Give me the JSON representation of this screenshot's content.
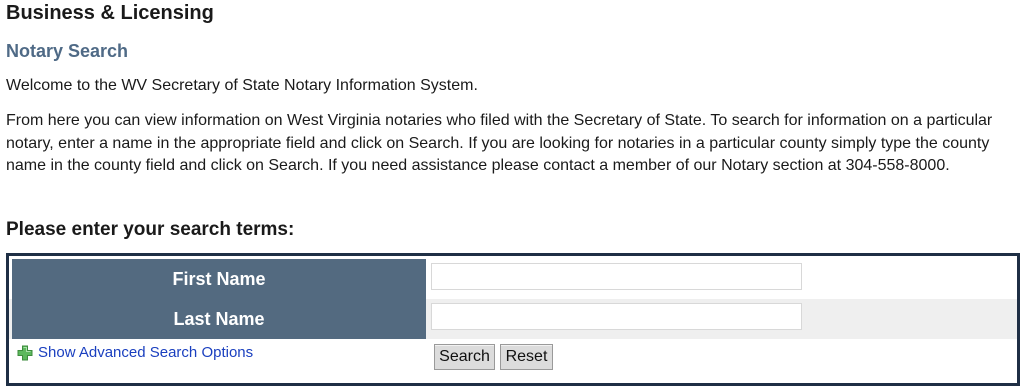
{
  "header": {
    "section_title": "Business & Licensing",
    "page_title": "Notary Search"
  },
  "intro": {
    "welcome": "Welcome to the WV Secretary of State Notary Information System.",
    "description": "From here you can view information on West Virginia notaries who filed with the Secretary of State. To search for information on a particular notary, enter a name in the appropriate field and click on Search. If you are looking for notaries in a particular county simply type the county name in the county field and click on Search. If you need assistance please contact a member of our Notary section at 304-558-8000."
  },
  "search": {
    "heading": "Please enter your search terms:",
    "first_name_label": "First Name",
    "first_name_value": "",
    "last_name_label": "Last Name",
    "last_name_value": "",
    "advanced_link": "Show Advanced Search Options",
    "advanced_icon": "plus-icon",
    "search_button": "Search",
    "reset_button": "Reset"
  },
  "colors": {
    "label_cell_bg": "#536a80",
    "frame_border": "#1f2f45",
    "subtitle": "#4f6a86",
    "link": "#1a3fbf",
    "plus_icon": "#4caf50"
  }
}
